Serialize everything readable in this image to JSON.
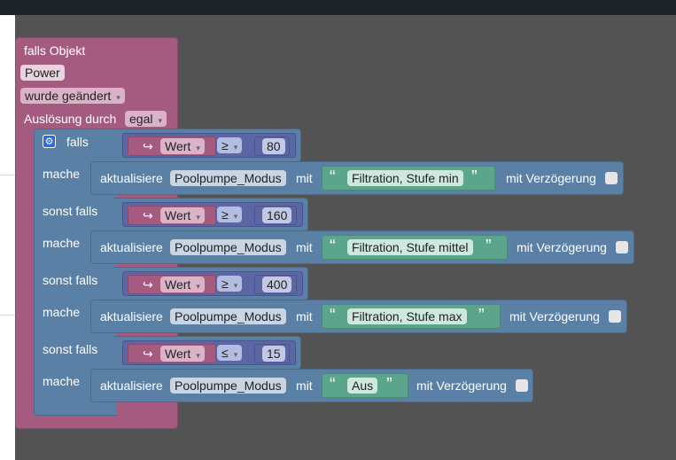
{
  "event": {
    "title": "falls Objekt",
    "object": "Power",
    "trigger": "wurde geändert",
    "by_label": "Auslösung durch",
    "by_value": "egal"
  },
  "ifblock": {
    "if_label": "falls",
    "do_label": "mache",
    "elseif_label": "sonst falls"
  },
  "conditions": [
    {
      "var": "Wert",
      "op": "≥",
      "value": "80"
    },
    {
      "var": "Wert",
      "op": "≥",
      "value": "160"
    },
    {
      "var": "Wert",
      "op": "≥",
      "value": "400"
    },
    {
      "var": "Wert",
      "op": "≤",
      "value": "15"
    }
  ],
  "actions": [
    {
      "verb": "aktualisiere",
      "state": "Poolpumpe_Modus",
      "with": "mit",
      "text": "Filtration, Stufe min",
      "delay": "mit Verzögerung"
    },
    {
      "verb": "aktualisiere",
      "state": "Poolpumpe_Modus",
      "with": "mit",
      "text": "Filtration, Stufe mittel",
      "delay": "mit Verzögerung"
    },
    {
      "verb": "aktualisiere",
      "state": "Poolpumpe_Modus",
      "with": "mit",
      "text": "Filtration, Stufe max",
      "delay": "mit Verzögerung"
    },
    {
      "verb": "aktualisiere",
      "state": "Poolpumpe_Modus",
      "with": "mit",
      "text": "Aus",
      "delay": "mit Verzögerung"
    }
  ],
  "glyphs": {
    "var_arrow": "↪",
    "dropdown": "▾",
    "quote_open": "“",
    "quote_close": "”",
    "gear": "⚙"
  },
  "colors": {
    "event": "#a55b80",
    "logic": "#5b80a5",
    "math": "#5b67a5",
    "text": "#5ba58c",
    "background": "#535353"
  }
}
